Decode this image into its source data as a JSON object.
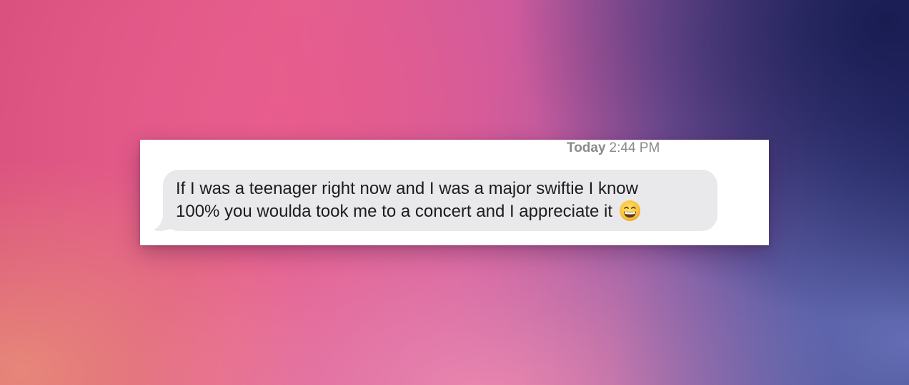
{
  "message": {
    "date_label": "Today",
    "time_label": "2:44 PM",
    "line1": "If I was a teenager right now and I was a major swiftie I know",
    "line2": "100% you woulda took me to a concert and I appreciate it",
    "emoji": "grinning-face-with-smiling-eyes-emoji"
  },
  "colors": {
    "bubble_bg": "#e9e9eb",
    "text": "#1c1c1e",
    "timestamp": "#8a8a8e",
    "card_bg": "#ffffff"
  }
}
